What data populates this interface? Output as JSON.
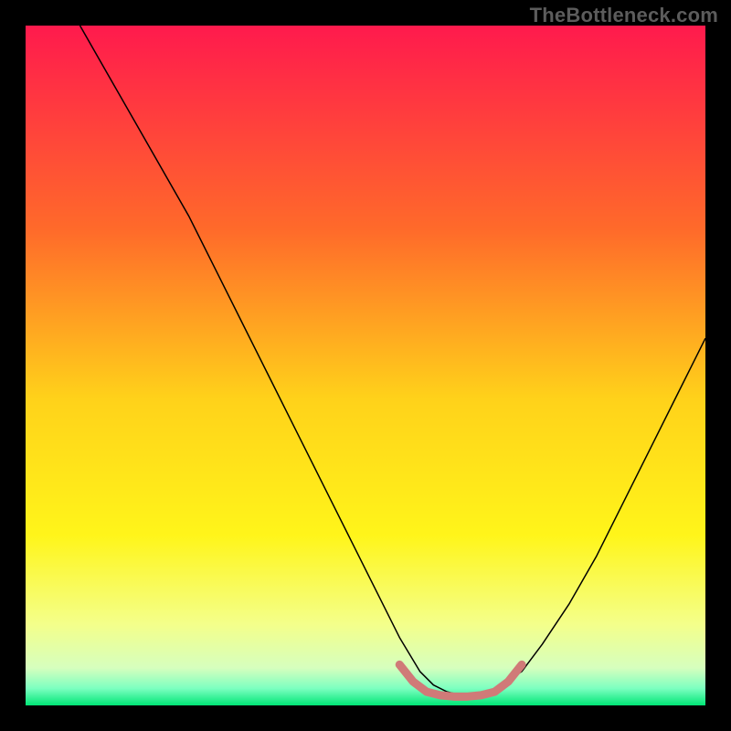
{
  "watermark": "TheBottleneck.com",
  "chart_data": {
    "type": "line",
    "title": "",
    "xlabel": "",
    "ylabel": "",
    "xlim": [
      0,
      100
    ],
    "ylim": [
      0,
      100
    ],
    "grid": false,
    "legend": false,
    "background_gradient": {
      "stops": [
        {
          "offset": 0.0,
          "color": "#ff1a4d"
        },
        {
          "offset": 0.3,
          "color": "#ff6a2a"
        },
        {
          "offset": 0.55,
          "color": "#ffd21a"
        },
        {
          "offset": 0.75,
          "color": "#fff51a"
        },
        {
          "offset": 0.88,
          "color": "#f4ff8a"
        },
        {
          "offset": 0.945,
          "color": "#d6ffbe"
        },
        {
          "offset": 0.975,
          "color": "#7cffc0"
        },
        {
          "offset": 1.0,
          "color": "#00e676"
        }
      ]
    },
    "series": [
      {
        "name": "bottleneck-curve",
        "stroke": "#000000",
        "stroke_width": 1.5,
        "x": [
          8,
          12,
          16,
          20,
          24,
          28,
          32,
          36,
          40,
          44,
          48,
          52,
          55,
          58,
          60,
          62,
          64,
          66,
          68,
          70,
          73,
          76,
          80,
          84,
          88,
          92,
          96,
          100
        ],
        "y": [
          100,
          93,
          86,
          79,
          72,
          64,
          56,
          48,
          40,
          32,
          24,
          16,
          10,
          5,
          3,
          2,
          1.5,
          1.5,
          2,
          3,
          5,
          9,
          15,
          22,
          30,
          38,
          46,
          54
        ]
      },
      {
        "name": "current-range-marker",
        "stroke": "#d07a78",
        "stroke_width": 9,
        "linecap": "round",
        "x": [
          55,
          57,
          59,
          61,
          63,
          65,
          67,
          69,
          71,
          73
        ],
        "y": [
          6,
          3.5,
          2,
          1.5,
          1.3,
          1.3,
          1.5,
          2,
          3.5,
          6
        ]
      }
    ]
  }
}
